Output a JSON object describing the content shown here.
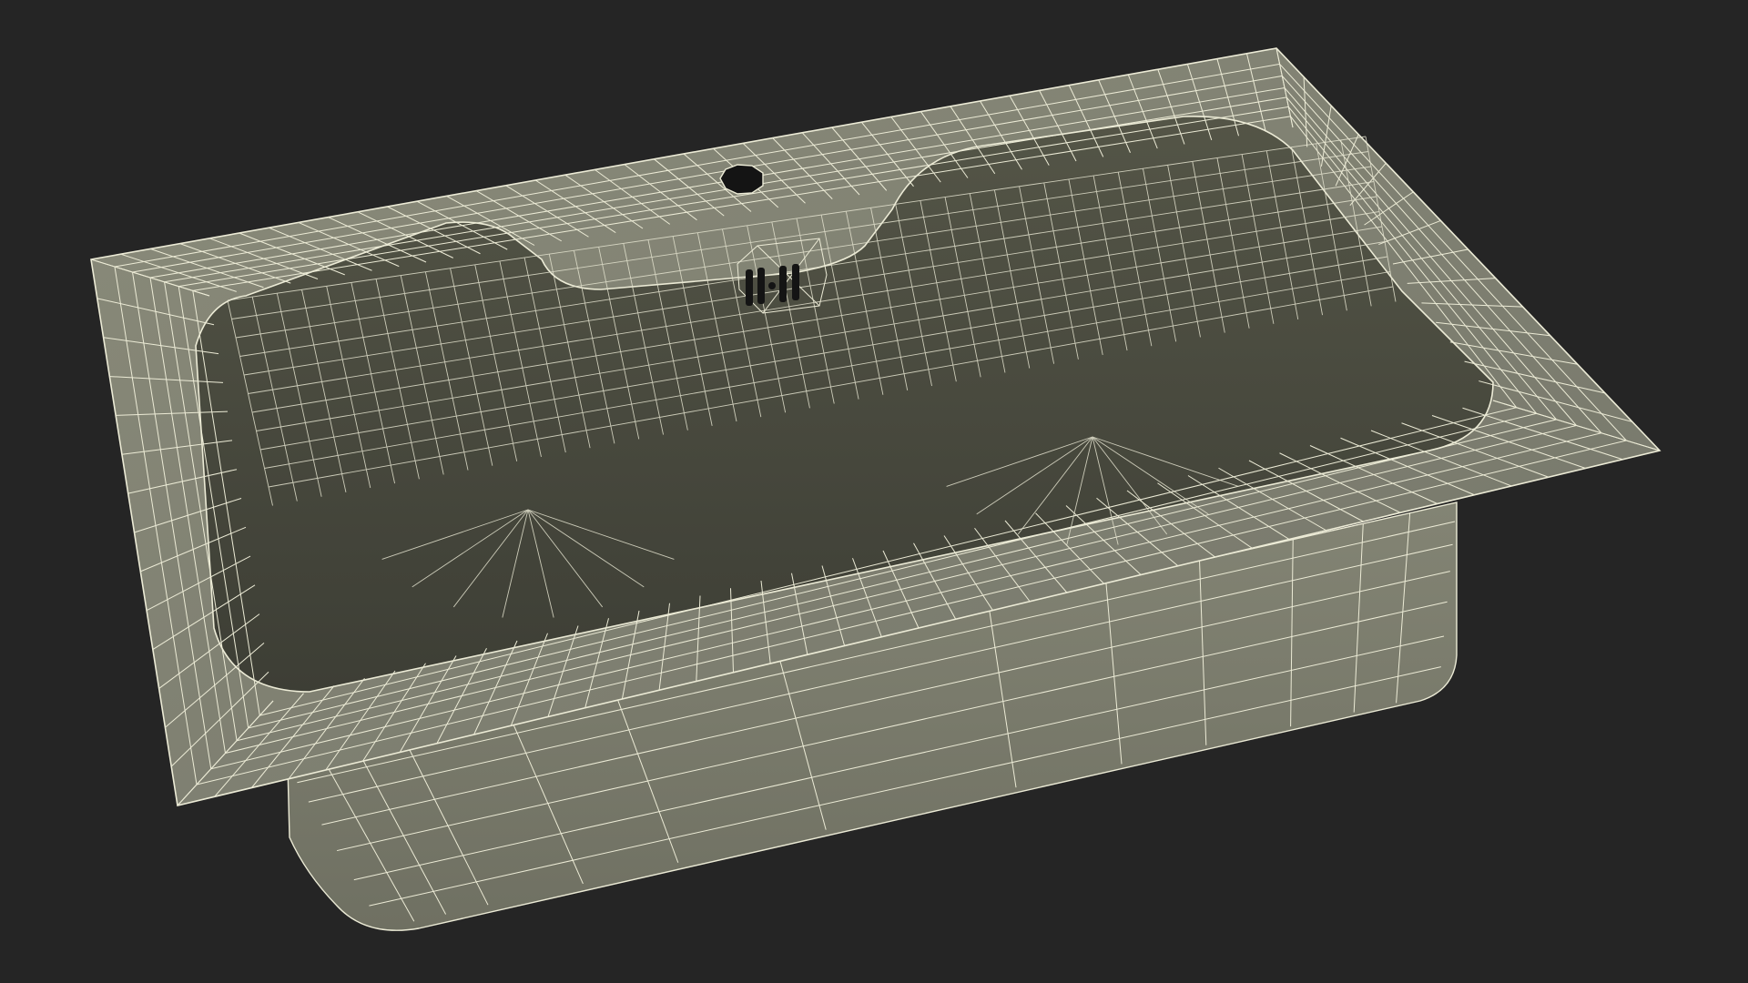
{
  "scene": {
    "subject": "bathtub-wireframe",
    "colors": {
      "background": "#252525",
      "surface_light": "#7c7d6d",
      "surface_mid": "#6a6b5c",
      "surface_dark": "#3f4037",
      "wire": "#ecebd6",
      "hole": "#141414"
    },
    "icons": [
      "overflow-drain-icon",
      "faucet-hole-icon"
    ]
  }
}
